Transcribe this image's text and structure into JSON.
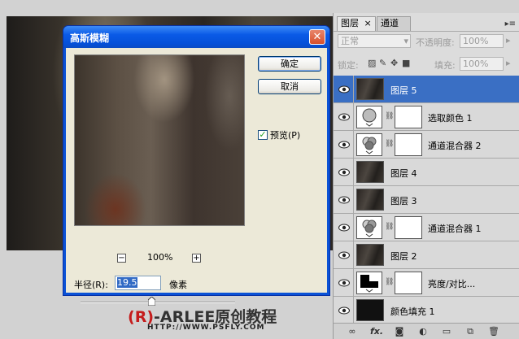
{
  "dialog": {
    "title": "高斯模糊",
    "ok_label": "确定",
    "cancel_label": "取消",
    "preview_label": "预览(P)",
    "preview_checked": true,
    "zoom_minus": "−",
    "zoom_plus": "+",
    "zoom_level": "100%",
    "radius_label": "半径(R):",
    "radius_value": "19.5",
    "radius_unit": "像素",
    "close_glyph": "✕"
  },
  "layers_panel": {
    "tabs": [
      {
        "label": "图层",
        "close": "×"
      },
      {
        "label": "通道"
      }
    ],
    "menu_glyph": "▸≡",
    "blend_mode": "正常",
    "opacity_label": "不透明度:",
    "opacity_value": "100%",
    "lock_label": "锁定:",
    "fill_label": "填充:",
    "fill_value": "100%",
    "layers": [
      {
        "name": "图层 5",
        "kind": "photo",
        "selected": true
      },
      {
        "name": "选取颜色 1",
        "kind": "adjust-selective"
      },
      {
        "name": "通道混合器 2",
        "kind": "adjust-mixer"
      },
      {
        "name": "图层 4",
        "kind": "photo"
      },
      {
        "name": "图层 3",
        "kind": "photo"
      },
      {
        "name": "通道混合器 1",
        "kind": "adjust-mixer"
      },
      {
        "name": "图层 2",
        "kind": "photo"
      },
      {
        "name": "亮度/对比...",
        "kind": "adjust-brightness"
      },
      {
        "name": "颜色填充 1",
        "kind": "fill"
      }
    ],
    "bottom_icons": [
      "link-icon",
      "fx-icon",
      "mask-icon",
      "adjustment-icon",
      "folder-icon",
      "new-layer-icon",
      "trash-icon"
    ],
    "fx_label": "fx."
  },
  "watermark": {
    "logo_mark": "R",
    "logo_text": "-ARLEE原创教程",
    "url": "HTTP://WWW.PSFLY.COM"
  },
  "colors": {
    "selection": "#3a6fc4",
    "titlebar": "#0a5ae6",
    "watermark_red": "#c51c1c"
  }
}
